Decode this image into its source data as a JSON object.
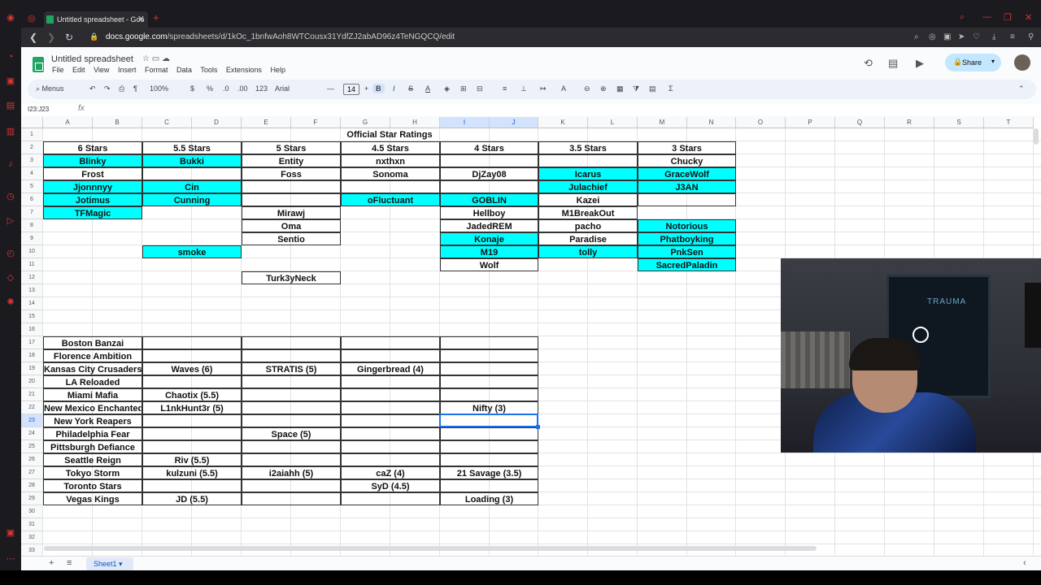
{
  "browser": {
    "tab_title": "Untitled spreadsheet - Goo",
    "tab_close": "✕",
    "newtab": "+",
    "url_host": "docs.google.com",
    "url_path": "/spreadsheets/d/1kOc_1bnfwAoh8WTCousx31YdfZJ2abAD96z4TeNGQCQ/edit",
    "nav_back": "❮",
    "nav_forward": "❯",
    "nav_reload": "↻",
    "lock_icon": "🔒"
  },
  "app": {
    "doc_title": "Untitled spreadsheet",
    "title_icons": "☆  ▭  ☁",
    "menus": [
      "File",
      "Edit",
      "View",
      "Insert",
      "Format",
      "Data",
      "Tools",
      "Extensions",
      "Help"
    ],
    "share_label": "Share",
    "share_lock": "🔒",
    "share_caret": "▾",
    "history_icon": "⟲",
    "comment_icon": "▤",
    "meet_icon": "▶",
    "toolbar": {
      "search_menus": "Menus",
      "undo": "↶",
      "redo": "↷",
      "print": "⎙",
      "paint": "¶",
      "zoom": "100%",
      "currency": "$",
      "percent": "%",
      "dec_less": ".0",
      "dec_more": ".00",
      "more_formats": "123",
      "font": "Arial",
      "minus": "—",
      "font_size": "14",
      "plus": "+",
      "bold": "B",
      "italic": "I",
      "strike": "S",
      "textcolor": "A",
      "fill": "◈",
      "borders": "⊞",
      "merge": "⊟",
      "halign": "≡",
      "valign": "⊥",
      "wrap": "↦",
      "rotate": "A",
      "link": "⊖",
      "comment": "⊕",
      "chart": "▦",
      "filter": "⧩",
      "views": "▤",
      "functions": "Σ",
      "collapse": "⌃"
    },
    "name_box": "I23:J23",
    "fx": "fx",
    "columns": [
      "A",
      "B",
      "C",
      "D",
      "E",
      "F",
      "G",
      "H",
      "I",
      "J",
      "K",
      "L",
      "M",
      "N",
      "O",
      "P",
      "Q",
      "R",
      "S",
      "T"
    ],
    "rows": [
      "1",
      "2",
      "3",
      "4",
      "5",
      "6",
      "7",
      "8",
      "9",
      "10",
      "11",
      "12",
      "13",
      "14",
      "15",
      "16",
      "17",
      "18",
      "19",
      "20",
      "21",
      "22",
      "23",
      "24",
      "25",
      "26",
      "27",
      "28",
      "29",
      "30",
      "31",
      "32",
      "33",
      "34"
    ],
    "sheet_tab": "Sheet1",
    "sheet_tab_caret": "▾",
    "add_sheet": "+",
    "all_sheets": "≡",
    "explore": "‹"
  },
  "sheet": {
    "title": "Official Star Ratings",
    "star_headers": [
      "6 Stars",
      "5.5 Stars",
      "5 Stars",
      "4.5 Stars",
      "4 Stars",
      "3.5 Stars",
      "3 Stars"
    ],
    "star_rows": [
      [
        "Blinky",
        "Bukki",
        "Entity",
        "nxthxn",
        "",
        "",
        "Chucky"
      ],
      [
        "Frost",
        "",
        "Foss",
        "Sonoma",
        "DjZay08",
        "Icarus",
        "GraceWolf"
      ],
      [
        "Jjonnnyy",
        "Cin",
        "",
        "",
        "",
        "Julachief",
        "J3AN"
      ],
      [
        "Jotimus",
        "Cunning",
        "",
        "oFluctuant",
        "GOBLIN",
        "Kazei",
        ""
      ],
      [
        "TFMagic",
        "",
        "Mirawj",
        "",
        "Hellboy",
        "M1BreakOut",
        ""
      ],
      [
        "",
        "",
        "Oma",
        "",
        "JadedREM",
        "pacho",
        "Notorious"
      ],
      [
        "",
        "",
        "Sentio",
        "",
        "Konaje",
        "Paradise",
        "Phatboyking"
      ],
      [
        "",
        "smoke",
        "",
        "",
        "M19",
        "tolly",
        "PnkSen"
      ],
      [
        "",
        "",
        "",
        "",
        "Wolf",
        "",
        "SacredPaladin"
      ],
      [
        "",
        "",
        "Turk3yNeck",
        "",
        "",
        "",
        ""
      ]
    ],
    "team_rows": [
      [
        "Boston Banzai",
        "",
        "",
        "",
        ""
      ],
      [
        "Florence Ambition",
        "",
        "",
        "",
        ""
      ],
      [
        "Kansas City Crusaders",
        "Waves (6)",
        "STRATIS (5)",
        "Gingerbread (4)",
        ""
      ],
      [
        "LA Reloaded",
        "",
        "",
        "",
        ""
      ],
      [
        "Miami Mafia",
        "Chaotix (5.5)",
        "",
        "",
        ""
      ],
      [
        "New Mexico Enchanted",
        "L1nkHunt3r (5)",
        "",
        "",
        "Nifty (3)"
      ],
      [
        "New York Reapers",
        "",
        "",
        "",
        ""
      ],
      [
        "Philadelphia Fear",
        "",
        "Space (5)",
        "",
        ""
      ],
      [
        "Pittsburgh Defiance",
        "",
        "",
        "",
        ""
      ],
      [
        "Seattle Reign",
        "Riv (5.5)",
        "",
        "",
        ""
      ],
      [
        "Tokyo Storm",
        "kulzuni (5.5)",
        "i2aiahh (5)",
        "caZ (4)",
        "21 Savage (3.5)"
      ],
      [
        "Toronto Stars",
        "",
        "",
        "SyD (4.5)",
        ""
      ],
      [
        "Vegas Kings",
        "JD (5.5)",
        "",
        "",
        "Loading (3)"
      ]
    ],
    "highlight_color": "#00ffff"
  },
  "webcam": {
    "poster_text": "TRAUMA"
  }
}
